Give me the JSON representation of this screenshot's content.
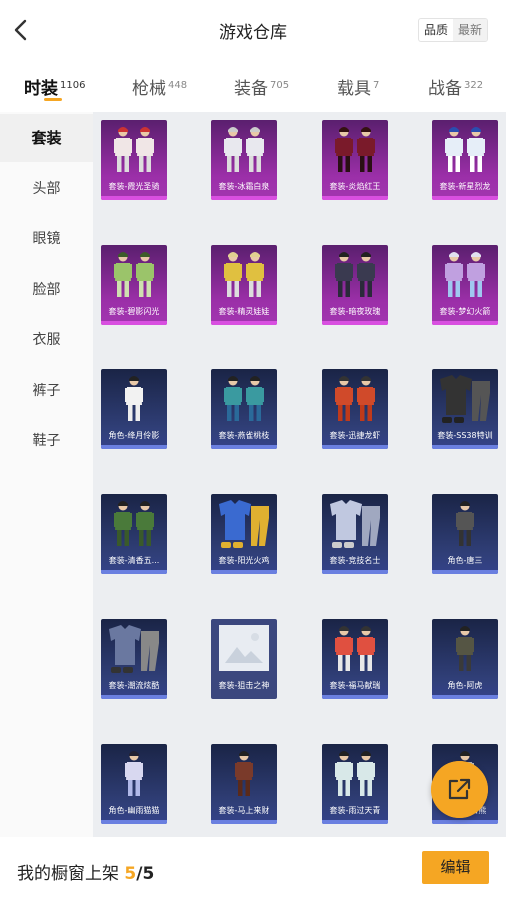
{
  "header": {
    "title": "游戏仓库",
    "toggle": [
      "品质",
      "最新"
    ],
    "toggle_active": 1
  },
  "tabs": [
    {
      "label": "时装",
      "count": "1106",
      "active": true
    },
    {
      "label": "枪械",
      "count": "448"
    },
    {
      "label": "装备",
      "count": "705"
    },
    {
      "label": "载具",
      "count": "7"
    },
    {
      "label": "战备",
      "count": "322"
    }
  ],
  "sidebar": {
    "items": [
      "套装",
      "头部",
      "眼镜",
      "脸部",
      "衣服",
      "裤子",
      "鞋子"
    ],
    "active": 0
  },
  "items": [
    {
      "name": "套装-霞光圣骑",
      "rarity": "purple",
      "icon": "outfit-pair-icon"
    },
    {
      "name": "套装-冰霜白泉",
      "rarity": "purple",
      "icon": "outfit-pair-icon"
    },
    {
      "name": "套装-炎焰红王",
      "rarity": "purple",
      "icon": "outfit-pair-icon"
    },
    {
      "name": "套装-新星烈龙",
      "rarity": "purple",
      "icon": "outfit-pair-icon"
    },
    {
      "name": "套装-碧影闪光",
      "rarity": "purple",
      "icon": "outfit-pair-icon"
    },
    {
      "name": "套装-精灵娃娃",
      "rarity": "purple",
      "icon": "outfit-pair-icon"
    },
    {
      "name": "套装-暗夜玫瑰",
      "rarity": "purple",
      "icon": "outfit-pair-icon"
    },
    {
      "name": "套装-梦幻火箭",
      "rarity": "purple",
      "icon": "outfit-pair-icon"
    },
    {
      "name": "角色-绛月伶影",
      "rarity": "blue",
      "icon": "character-icon"
    },
    {
      "name": "套装-燕雀桃枝",
      "rarity": "blue",
      "icon": "outfit-pair-icon"
    },
    {
      "name": "套装-迅捷龙虾",
      "rarity": "blue",
      "icon": "outfit-pair-icon"
    },
    {
      "name": "套装-SS38特训",
      "rarity": "blue",
      "icon": "clothes-set-icon"
    },
    {
      "name": "套装-清香五...",
      "rarity": "blue",
      "icon": "outfit-pair-icon"
    },
    {
      "name": "套装-阳光火鸡",
      "rarity": "blue",
      "icon": "clothes-set-icon"
    },
    {
      "name": "套装-竞技名士",
      "rarity": "blue",
      "icon": "clothes-set-icon"
    },
    {
      "name": "角色-唐三",
      "rarity": "blue",
      "icon": "character-icon"
    },
    {
      "name": "套装-潮流炫酷",
      "rarity": "blue",
      "icon": "clothes-set-icon"
    },
    {
      "name": "套装-狙击之神",
      "rarity": "placeholder",
      "icon": "image-placeholder-icon"
    },
    {
      "name": "套装-福马献瑞",
      "rarity": "blue",
      "icon": "outfit-pair-icon"
    },
    {
      "name": "角色-阿虎",
      "rarity": "blue",
      "icon": "character-icon"
    },
    {
      "name": "角色-幽雨猫猫",
      "rarity": "blue",
      "icon": "character-icon"
    },
    {
      "name": "套装-马上来财",
      "rarity": "blue",
      "icon": "character-icon"
    },
    {
      "name": "套装-雨过天青",
      "rarity": "blue",
      "icon": "outfit-pair-icon"
    },
    {
      "name": "套装-...白熊",
      "rarity": "blue",
      "icon": "character-icon"
    }
  ],
  "fab": {
    "icon": "share-external-icon"
  },
  "footer": {
    "label": "我的橱窗上架",
    "count": "5",
    "total": "5",
    "edit_label": "编辑"
  },
  "colors": {
    "accent": "#f5a623",
    "purple": "#9b2fa8",
    "blue": "#303f78"
  }
}
